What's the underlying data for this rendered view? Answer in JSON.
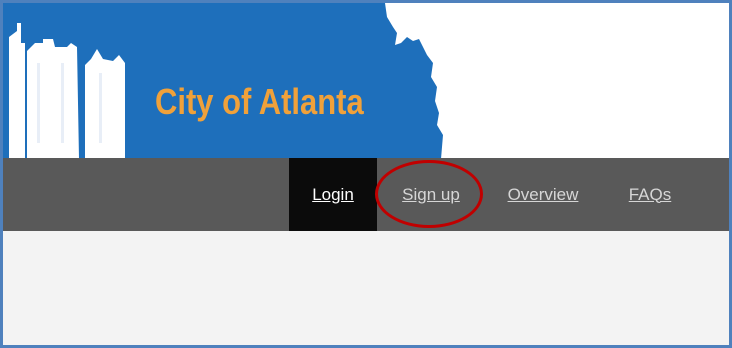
{
  "header": {
    "site_title": "City of Atlanta",
    "brand_color": "#1e6fbb",
    "title_color": "#f0a13a"
  },
  "nav": {
    "items": [
      {
        "label": "Login",
        "active": true
      },
      {
        "label": "Sign up",
        "active": false,
        "highlighted": true
      },
      {
        "label": "Overview",
        "active": false
      },
      {
        "label": "FAQs",
        "active": false
      }
    ],
    "bar_color": "#595959",
    "active_color": "#0b0b0b",
    "highlight_color": "#c00000"
  }
}
